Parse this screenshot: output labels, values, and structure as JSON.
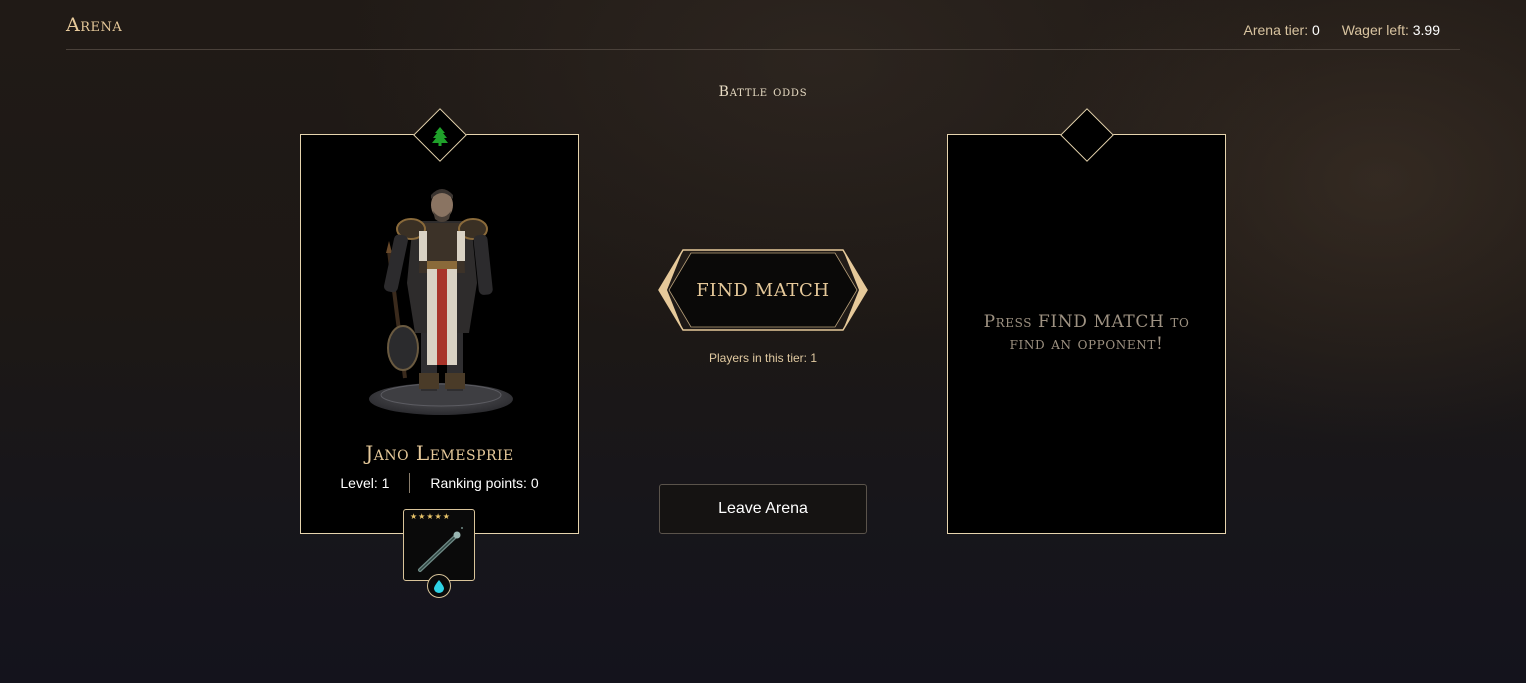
{
  "header": {
    "title": "Arena",
    "arena_tier_label": "Arena tier:",
    "arena_tier_value": "0",
    "wager_left_label": "Wager left:",
    "wager_left_value": "3.99"
  },
  "battle_odds_label": "Battle odds",
  "player": {
    "name": "Jano Lemesprie",
    "level_text": "Level: 1",
    "ranking_text": "Ranking points: 0",
    "class_icon": "tree-icon",
    "item": {
      "stars": "★★★★★",
      "rating": 5,
      "icon": "staff-icon",
      "element_icon": "water-drop-icon"
    }
  },
  "find_match": {
    "label": "FIND MATCH",
    "players_in_tier": "Players in this tier: 1"
  },
  "leave_button": "Leave Arena",
  "opponent": {
    "placeholder": "Press FIND MATCH to find an opponent!"
  },
  "colors": {
    "gold": "#e6c99a",
    "card_border": "#e6d4ae",
    "tree_green": "#1fa12a",
    "water_cyan": "#2ed3e6"
  }
}
